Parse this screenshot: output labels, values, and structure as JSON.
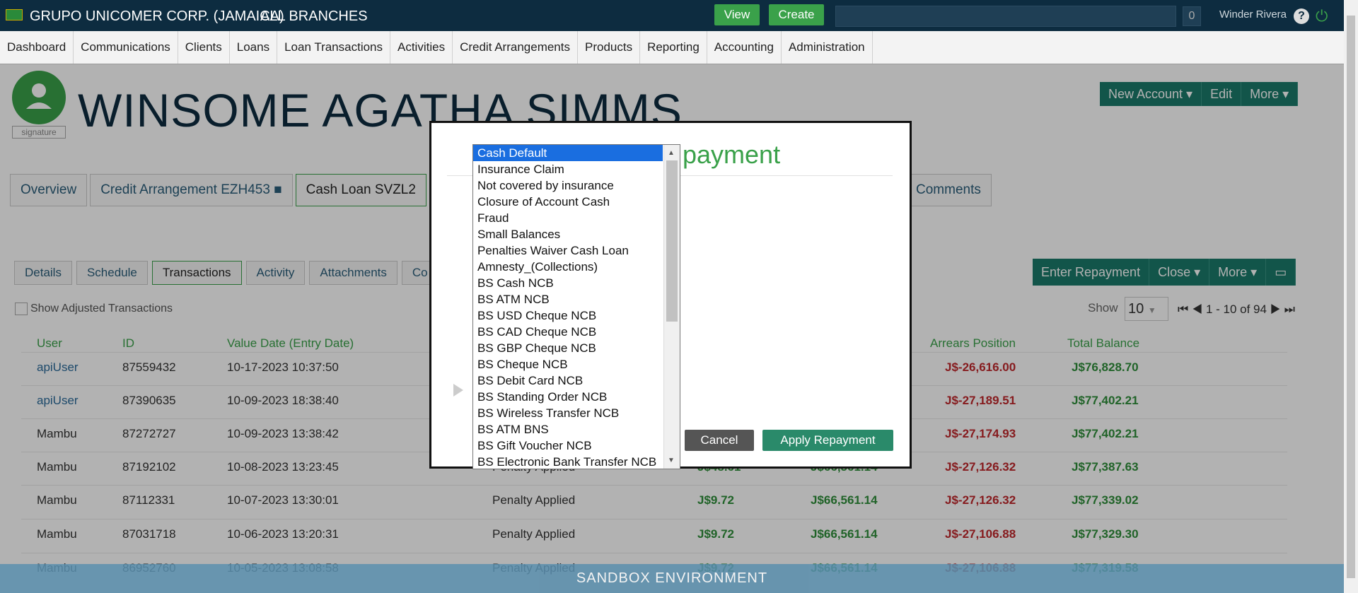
{
  "topbar": {
    "org": "GRUPO UNICOMER CORP. (JAMAICA)",
    "branch": "ALL BRANCHES",
    "view": "View",
    "create": "Create",
    "count": "0",
    "user": "Winder Rivera",
    "help": "?"
  },
  "nav": [
    "Dashboard",
    "Communications",
    "Clients",
    "Loans",
    "Loan Transactions",
    "Activities",
    "Credit Arrangements",
    "Products",
    "Reporting",
    "Accounting",
    "Administration"
  ],
  "client": {
    "name": "WINSOME AGATHA SIMMS",
    "signature": "signature"
  },
  "header_buttons": [
    "New Account ▾",
    "Edit",
    "More ▾"
  ],
  "tabs": [
    {
      "label": "Overview"
    },
    {
      "label": "Credit Arrangement EZH453 ■"
    },
    {
      "label": "Cash Loan SVZL2"
    },
    {
      "label": "Comments"
    }
  ],
  "subtabs": [
    "Details",
    "Schedule",
    "Transactions",
    "Activity",
    "Attachments",
    "Co"
  ],
  "tx_buttons": [
    "Enter Repayment",
    "Close ▾",
    "More ▾"
  ],
  "show_adjusted": "Show Adjusted Transactions",
  "pager": {
    "show": "Show",
    "size": "10",
    "range": "1 - 10 of 94"
  },
  "columns": {
    "user": "User",
    "id": "ID",
    "date": "Value Date (Entry Date)",
    "arrears": "Arrears Position",
    "total": "Total Balance"
  },
  "rows": [
    {
      "user": "apiUser",
      "id": "87559432",
      "date": "10-17-2023 10:37:50",
      "type": "",
      "amt": "",
      "bal": "",
      "arrears": "J$-26,616.00",
      "total": "J$76,828.70"
    },
    {
      "user": "apiUser",
      "id": "87390635",
      "date": "10-09-2023 18:38:40",
      "type": "",
      "amt": "",
      "bal": "",
      "arrears": "J$-27,189.51",
      "total": "J$77,402.21"
    },
    {
      "user": "Mambu",
      "id": "87272727",
      "date": "10-09-2023 13:38:42",
      "type": "",
      "amt": "",
      "bal": "",
      "arrears": "J$-27,174.93",
      "total": "J$77,402.21"
    },
    {
      "user": "Mambu",
      "id": "87192102",
      "date": "10-08-2023 13:23:45",
      "type": "Penalty Applied",
      "amt": "J$48.61",
      "bal": "J$66,561.14",
      "arrears": "J$-27,126.32",
      "total": "J$77,387.63"
    },
    {
      "user": "Mambu",
      "id": "87112331",
      "date": "10-07-2023 13:30:01",
      "type": "Penalty Applied",
      "amt": "J$9.72",
      "bal": "J$66,561.14",
      "arrears": "J$-27,126.32",
      "total": "J$77,339.02"
    },
    {
      "user": "Mambu",
      "id": "87031718",
      "date": "10-06-2023 13:20:31",
      "type": "Penalty Applied",
      "amt": "J$9.72",
      "bal": "J$66,561.14",
      "arrears": "J$-27,106.88",
      "total": "J$77,329.30"
    },
    {
      "user": "Mambu",
      "id": "86952760",
      "date": "10-05-2023 13:08:58",
      "type": "Penalty Applied",
      "amt": "J$9.72",
      "bal": "J$66,561.14",
      "arrears": "J$-27,106.88",
      "total": "J$77,319.58"
    }
  ],
  "dialog": {
    "title": "payment",
    "cancel": "Cancel",
    "apply": "Apply Repayment",
    "options": [
      "Cash Default",
      "Insurance Claim",
      "Not covered by insurance",
      "Closure of Account Cash",
      "Fraud",
      "Small Balances",
      "Penalties Waiver Cash Loan",
      "Amnesty_(Collections)",
      "BS Cash NCB",
      "BS ATM NCB",
      "BS USD Cheque NCB",
      "BS CAD Cheque NCB",
      "BS GBP Cheque NCB",
      "BS Cheque NCB",
      "BS Debit Card NCB",
      "BS Standing Order NCB",
      "BS Wireless Transfer NCB",
      "BS ATM BNS",
      "BS Gift Voucher NCB",
      "BS Electronic Bank Transfer NCB"
    ],
    "selected": "Cash Default"
  },
  "sandbox": "SANDBOX ENVIRONMENT",
  "colors": {
    "topbar": "#0d2c40",
    "green": "#3aa14a",
    "teal": "#1b7a6a",
    "selected": "#1a6ee0"
  }
}
